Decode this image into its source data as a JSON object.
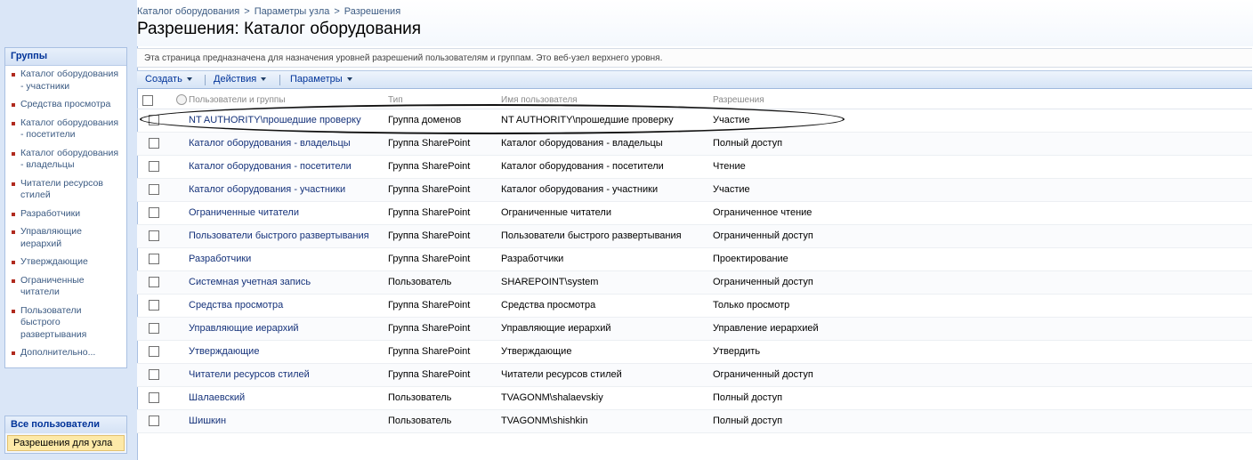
{
  "breadcrumb": {
    "items": [
      "Каталог оборудования",
      "Параметры узла",
      "Разрешения"
    ],
    "separator": ">"
  },
  "page_title": "Разрешения: Каталог оборудования",
  "quick_launch": {
    "header": "Группы",
    "items": [
      "Каталог оборудования - участники",
      "Средства просмотра",
      "Каталог оборудования - посетители",
      "Каталог оборудования - владельцы",
      "Читатели ресурсов стилей",
      "Разработчики",
      "Управляющие иерархий",
      "Утверждающие",
      "Ограниченные читатели",
      "Пользователи быстрого развертывания",
      "Дополнительно..."
    ],
    "all_users": "Все пользователи",
    "site_permissions": "Разрешения для узла"
  },
  "description": "Эта страница предназначена для назначения уровней разрешений пользователям и группам. Это веб-узел верхнего уровня.",
  "toolbar": {
    "create": "Создать",
    "actions": "Действия",
    "settings": "Параметры"
  },
  "table": {
    "headers": {
      "name": "Пользователи и группы",
      "type": "Тип",
      "username": "Имя пользователя",
      "permissions": "Разрешения"
    },
    "rows": [
      {
        "name": "NT AUTHORITY\\прошедшие проверку",
        "type": "Группа доменов",
        "username": "NT AUTHORITY\\прошедшие проверку",
        "permissions": "Участие"
      },
      {
        "name": "Каталог оборудования - владельцы",
        "type": "Группа SharePoint",
        "username": "Каталог оборудования - владельцы",
        "permissions": "Полный доступ"
      },
      {
        "name": "Каталог оборудования - посетители",
        "type": "Группа SharePoint",
        "username": "Каталог оборудования - посетители",
        "permissions": "Чтение"
      },
      {
        "name": "Каталог оборудования - участники",
        "type": "Группа SharePoint",
        "username": "Каталог оборудования - участники",
        "permissions": "Участие"
      },
      {
        "name": "Ограниченные читатели",
        "type": "Группа SharePoint",
        "username": "Ограниченные читатели",
        "permissions": "Ограниченное чтение"
      },
      {
        "name": "Пользователи быстрого развертывания",
        "type": "Группа SharePoint",
        "username": "Пользователи быстрого развертывания",
        "permissions": "Ограниченный доступ"
      },
      {
        "name": "Разработчики",
        "type": "Группа SharePoint",
        "username": "Разработчики",
        "permissions": "Проектирование"
      },
      {
        "name": "Системная учетная запись",
        "type": "Пользователь",
        "username": "SHAREPOINT\\system",
        "permissions": "Ограниченный доступ"
      },
      {
        "name": "Средства просмотра",
        "type": "Группа SharePoint",
        "username": "Средства просмотра",
        "permissions": "Только просмотр"
      },
      {
        "name": "Управляющие иерархий",
        "type": "Группа SharePoint",
        "username": "Управляющие иерархий",
        "permissions": "Управление иерархией"
      },
      {
        "name": "Утверждающие",
        "type": "Группа SharePoint",
        "username": "Утверждающие",
        "permissions": "Утвердить"
      },
      {
        "name": "Читатели ресурсов стилей",
        "type": "Группа SharePoint",
        "username": "Читатели ресурсов стилей",
        "permissions": "Ограниченный доступ"
      },
      {
        "name": "Шалаевский",
        "type": "Пользователь",
        "username": "TVAGONM\\shalaevskiy",
        "permissions": "Полный доступ"
      },
      {
        "name": "Шишкин",
        "type": "Пользователь",
        "username": "TVAGONM\\shishkin",
        "permissions": "Полный доступ"
      }
    ]
  }
}
